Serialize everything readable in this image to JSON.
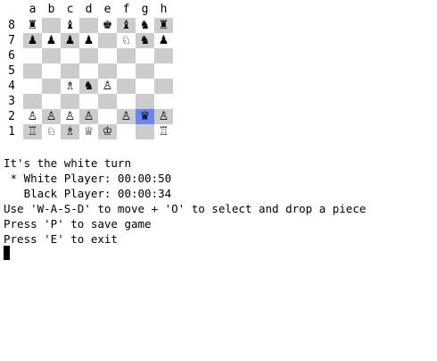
{
  "board": {
    "files": [
      "a",
      "b",
      "c",
      "d",
      "e",
      "f",
      "g",
      "h"
    ],
    "ranks": [
      "8",
      "7",
      "6",
      "5",
      "4",
      "3",
      "2",
      "1"
    ],
    "highlight": {
      "file": "g",
      "rank": "2",
      "color": "#6688ee"
    },
    "rows": [
      [
        "♜",
        "",
        "♝",
        "",
        "♚",
        "♝",
        "♞",
        "♜"
      ],
      [
        "♟",
        "♟",
        "♟",
        "♟",
        "",
        "♘",
        "♞",
        "♟"
      ],
      [
        "",
        "",
        "",
        "",
        "",
        "",
        "",
        ""
      ],
      [
        "",
        "",
        "",
        "",
        "",
        "",
        "",
        ""
      ],
      [
        "",
        "",
        "♗",
        "♞",
        "♙",
        "",
        "",
        ""
      ],
      [
        "",
        "",
        "",
        "",
        "",
        "",
        "",
        ""
      ],
      [
        "♙",
        "♙",
        "♙",
        "♙",
        "",
        "♙",
        "♛",
        "♙"
      ],
      [
        "♖",
        "♘",
        "♗",
        "♕",
        "♔",
        "",
        "",
        "♖"
      ]
    ]
  },
  "terminal": {
    "turn": "It's the white turn",
    "white_player": " * White Player: 00:00:50",
    "black_player": "   Black Player: 00:00:34",
    "instructions": "Use 'W-A-S-D' to move + 'O' to select and drop a piece",
    "save_hint": "Press 'P' to save game",
    "exit_hint": "Press 'E' to exit"
  }
}
